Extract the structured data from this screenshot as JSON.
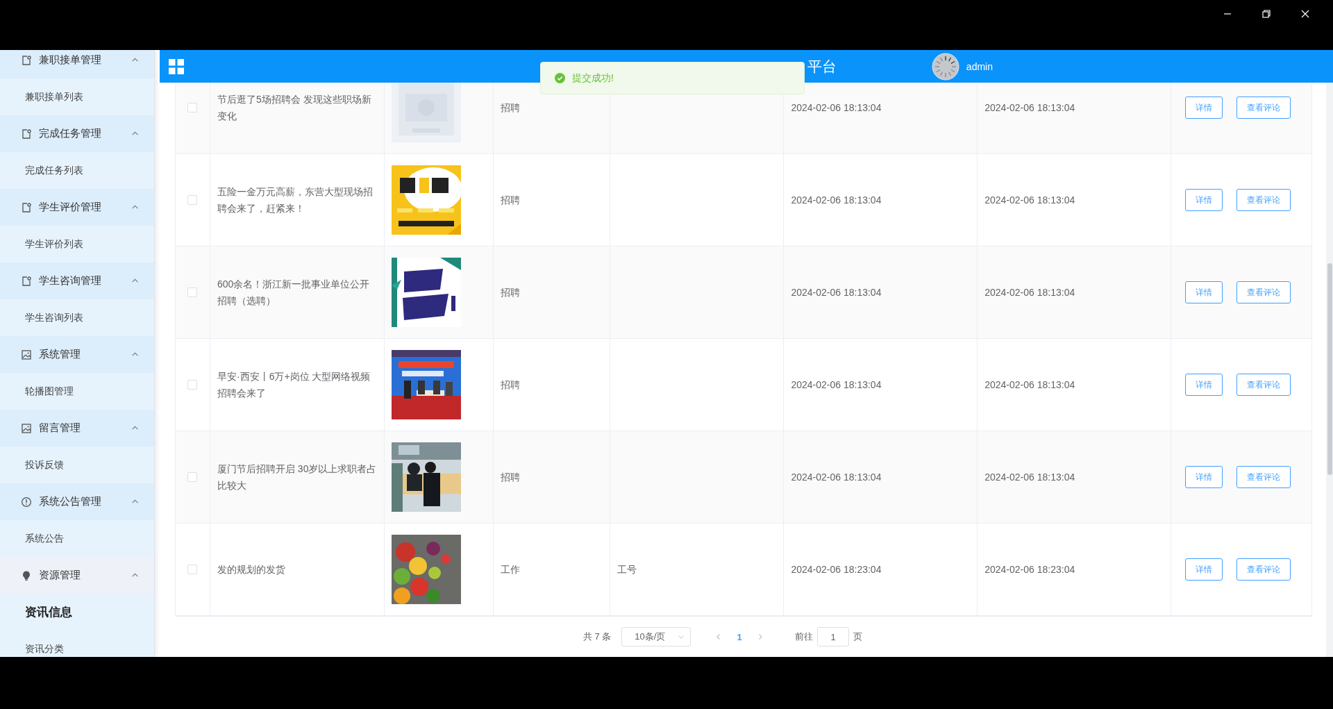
{
  "header": {
    "title": "平台",
    "user": {
      "name": "admin"
    }
  },
  "toast": {
    "message": "提交成功!"
  },
  "sidebar": {
    "groups": [
      {
        "label": "兼职接单管理",
        "expanded": true,
        "children": [
          {
            "label": "兼职接单列表",
            "selected": false
          }
        ]
      },
      {
        "label": "完成任务管理",
        "expanded": true,
        "children": [
          {
            "label": "完成任务列表",
            "selected": false
          }
        ]
      },
      {
        "label": "学生评价管理",
        "expanded": true,
        "children": [
          {
            "label": "学生评价列表",
            "selected": false
          }
        ]
      },
      {
        "label": "学生咨询管理",
        "expanded": true,
        "children": [
          {
            "label": "学生咨询列表",
            "selected": false
          }
        ]
      },
      {
        "label": "系统管理",
        "expanded": true,
        "children": [
          {
            "label": "轮播图管理",
            "selected": false
          }
        ]
      },
      {
        "label": "留言管理",
        "expanded": true,
        "children": [
          {
            "label": "投诉反馈",
            "selected": false
          }
        ]
      },
      {
        "label": "系统公告管理",
        "expanded": true,
        "children": [
          {
            "label": "系统公告",
            "selected": false
          }
        ]
      },
      {
        "label": "资源管理",
        "expanded": true,
        "children": [
          {
            "label": "资讯信息",
            "selected": true
          },
          {
            "label": "资讯分类",
            "selected": false
          }
        ]
      }
    ]
  },
  "table": {
    "rows": [
      {
        "checked": false,
        "column_2": "节后逛了5场招聘会 发现这些职场新变化",
        "column_4": "招聘",
        "column_5": "",
        "column_6": "2024-02-06 18:13:04",
        "column_7": "2024-02-06 18:13:04",
        "actions": [
          "详情",
          "查看评论"
        ]
      },
      {
        "checked": false,
        "column_2": "五险一金万元高薪，东营大型现场招聘会来了，赶紧来！",
        "column_4": "招聘",
        "column_5": "",
        "column_6": "2024-02-06 18:13:04",
        "column_7": "2024-02-06 18:13:04",
        "actions": [
          "详情",
          "查看评论"
        ]
      },
      {
        "checked": false,
        "column_2": "600余名！浙江新一批事业单位公开招聘（选聘）",
        "column_4": "招聘",
        "column_5": "",
        "column_6": "2024-02-06 18:13:04",
        "column_7": "2024-02-06 18:13:04",
        "actions": [
          "详情",
          "查看评论"
        ]
      },
      {
        "checked": false,
        "column_2": "早安·西安丨6万+岗位 大型网络视频招聘会来了",
        "column_4": "招聘",
        "column_5": "",
        "column_6": "2024-02-06 18:13:04",
        "column_7": "2024-02-06 18:13:04",
        "actions": [
          "详情",
          "查看评论"
        ]
      },
      {
        "checked": false,
        "column_2": "厦门节后招聘开启 30岁以上求职者占比较大",
        "column_4": "招聘",
        "column_5": "",
        "column_6": "2024-02-06 18:13:04",
        "column_7": "2024-02-06 18:13:04",
        "actions": [
          "详情",
          "查看评论"
        ]
      },
      {
        "checked": false,
        "column_2": "发的规划的发货",
        "column_4": "工作",
        "column_5": "工号",
        "column_6": "2024-02-06 18:23:04",
        "column_7": "2024-02-06 18:23:04",
        "actions": [
          "详情",
          "查看评论"
        ]
      }
    ]
  },
  "pagination": {
    "total": "共 7 条",
    "page_size": "10条/页",
    "pages": [
      {
        "label": "1",
        "selected": true
      }
    ],
    "goto_label": "前往",
    "goto_value": "1",
    "goto_suffix": "页"
  }
}
